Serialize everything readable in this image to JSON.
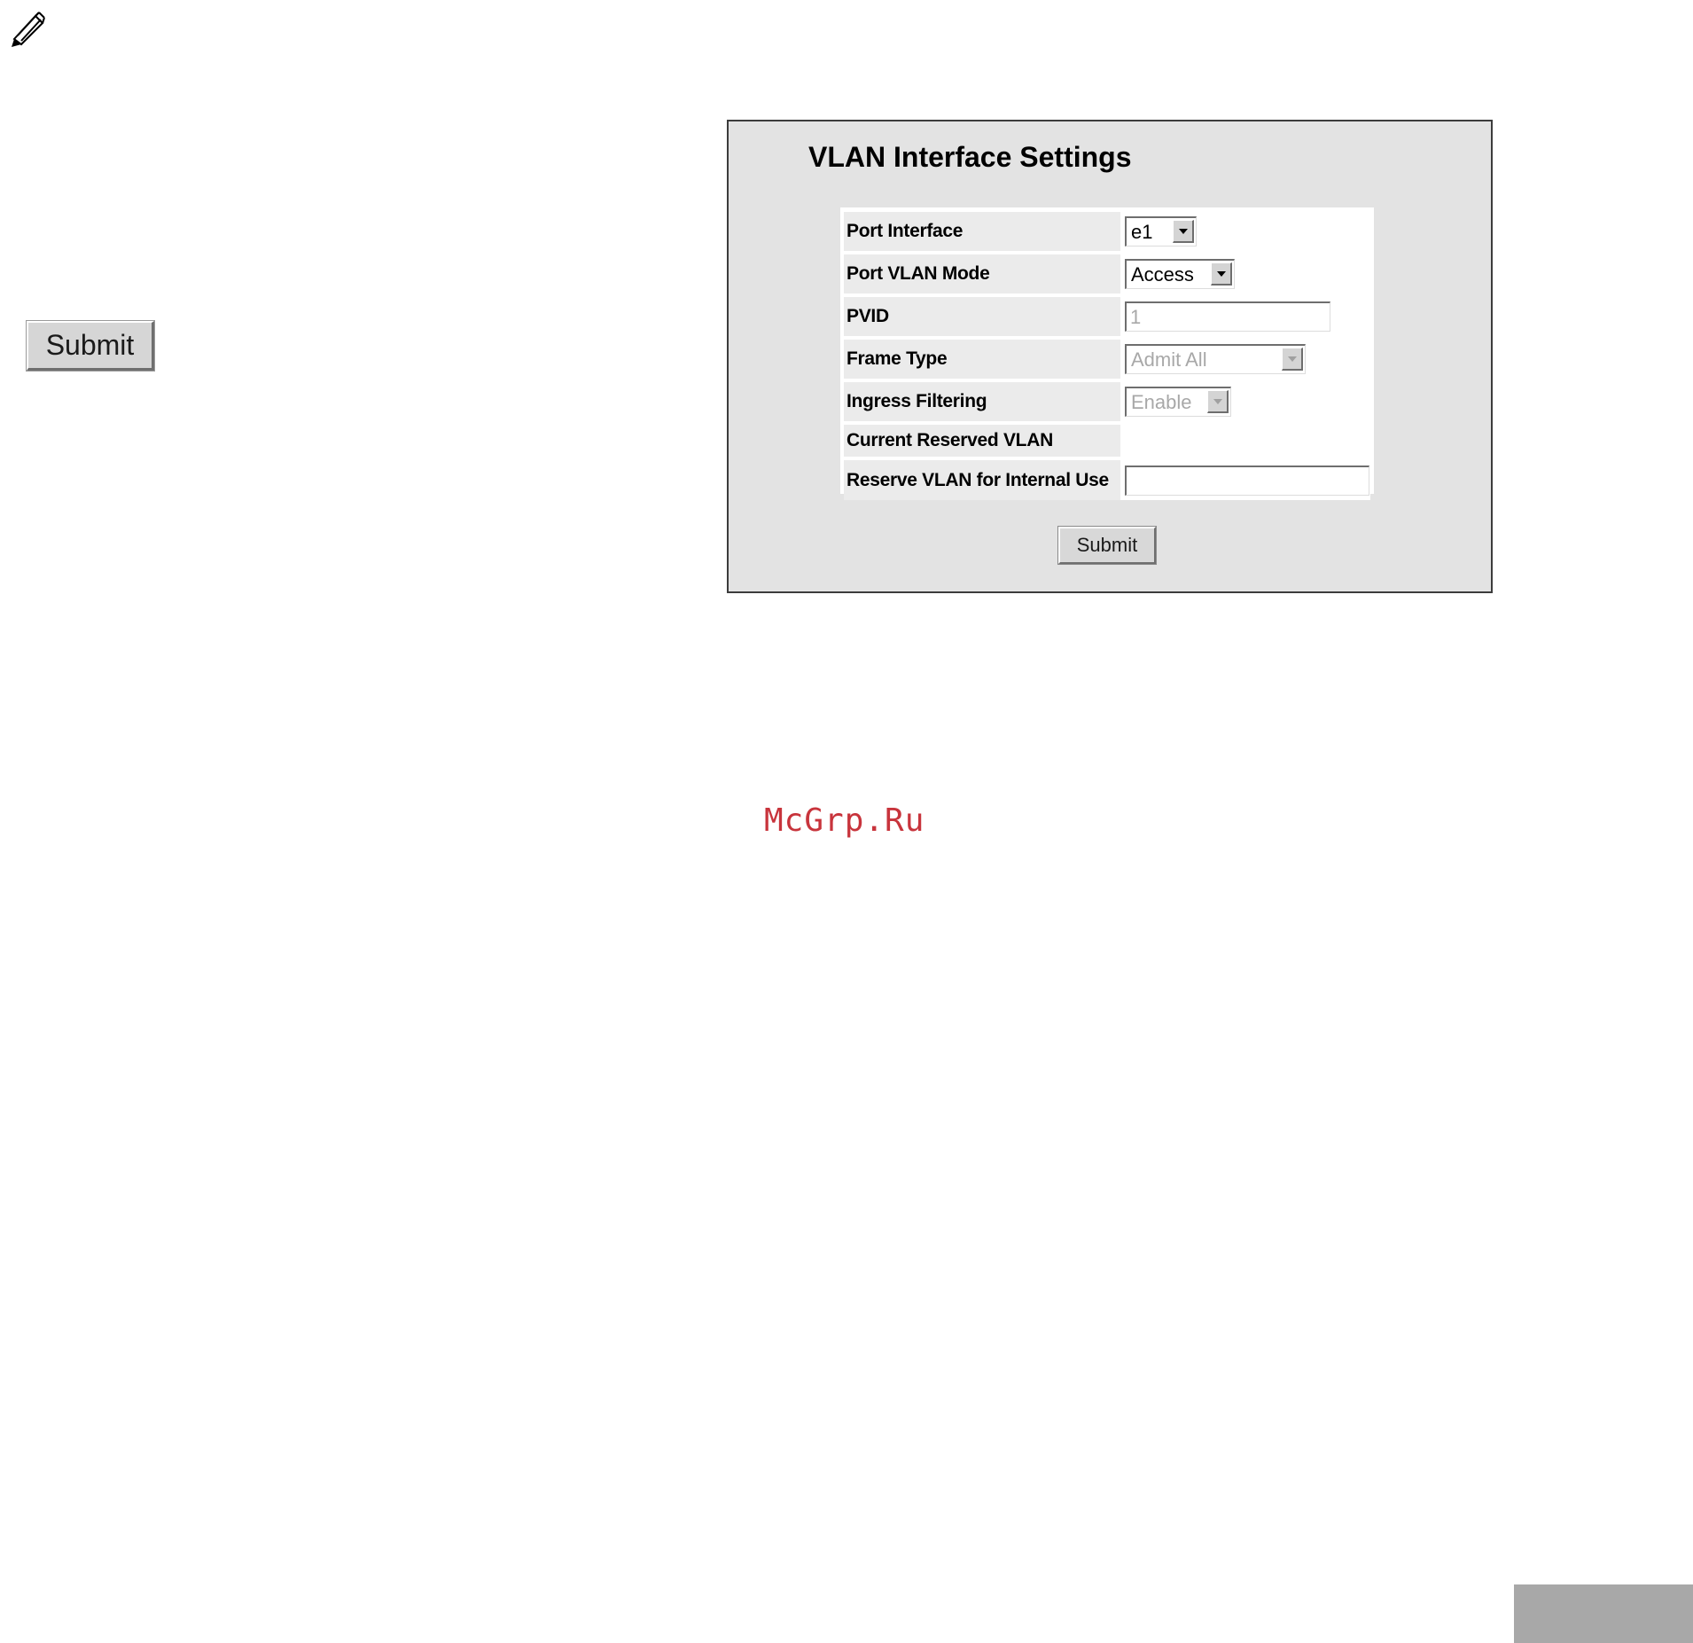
{
  "left_panel": {
    "submit_label": "Submit"
  },
  "vlan_panel": {
    "title": "VLAN Interface Settings",
    "rows": [
      {
        "label": "Port Interface",
        "value": "e1"
      },
      {
        "label": "Port VLAN Mode",
        "value": "Access"
      },
      {
        "label": "PVID",
        "value": "1"
      },
      {
        "label": "Frame Type",
        "value": "Admit All"
      },
      {
        "label": "Ingress Filtering",
        "value": "Enable"
      },
      {
        "label": "Current Reserved VLAN",
        "value": ""
      },
      {
        "label": "Reserve VLAN for Internal Use",
        "value": ""
      }
    ],
    "submit_label": "Submit"
  },
  "watermark": "McGrp.Ru",
  "icons": {
    "note": "pencil-icon"
  }
}
